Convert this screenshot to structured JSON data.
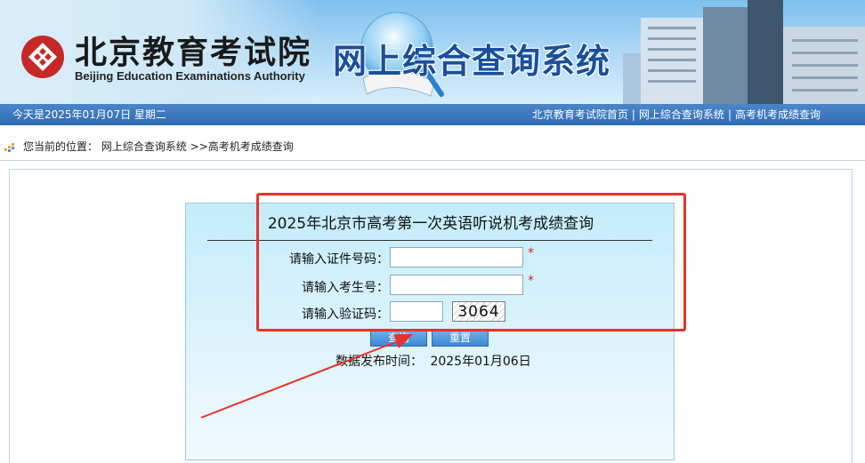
{
  "header": {
    "org_cn": "北京教育考试院",
    "org_en": "Beijing Education Examinations Authority",
    "site_title": "网上综合查询系统"
  },
  "navbar": {
    "date_text": "今天是2025年01月07日  星期二",
    "links": [
      "北京教育考试院首页",
      "网上综合查询系统",
      "高考机考成绩查询"
    ],
    "separator": "|"
  },
  "breadcrumb": {
    "prefix": "您当前的位置：",
    "path": "网上综合查询系统 >>高考机考成绩查询"
  },
  "form": {
    "title": "2025年北京市高考第一次英语听说机考成绩查询",
    "id_label": "请输入证件号码：",
    "id_value": "",
    "exam_label": "请输入考生号：",
    "exam_value": "",
    "captcha_label": "请输入验证码：",
    "captcha_value": "",
    "captcha_image_text": "3064",
    "required_mark": "*",
    "submit_label": "查询",
    "reset_label": "重置",
    "publish_label": "数据发布时间：",
    "publish_date": "2025年01月06日"
  },
  "colors": {
    "navbar": "#2f6cb3",
    "title_blue": "#1a4f9c",
    "annotation_red": "#e8322b",
    "required_red": "#e02020"
  }
}
